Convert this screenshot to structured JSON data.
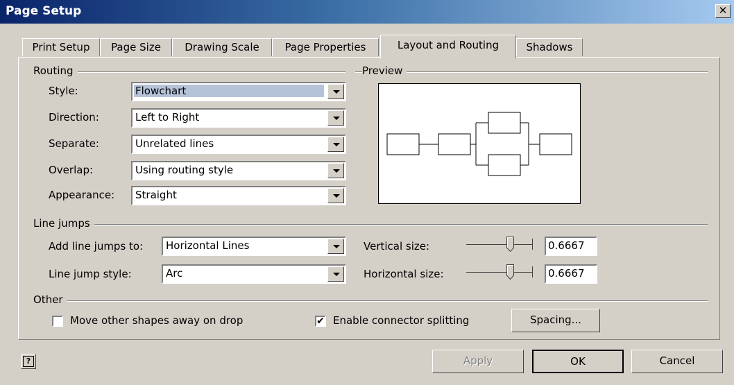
{
  "window": {
    "title": "Page Setup"
  },
  "tabs": [
    {
      "label": "Print Setup"
    },
    {
      "label": "Page Size"
    },
    {
      "label": "Drawing Scale"
    },
    {
      "label": "Page Properties"
    },
    {
      "label": "Layout and Routing",
      "active": true
    },
    {
      "label": "Shadows"
    }
  ],
  "routing": {
    "group_label": "Routing",
    "style": {
      "label": "Style:",
      "value": "Flowchart"
    },
    "direction": {
      "label": "Direction:",
      "value": "Left to Right"
    },
    "separate": {
      "label": "Separate:",
      "value": "Unrelated lines"
    },
    "overlap": {
      "label": "Overlap:",
      "value": "Using routing style"
    },
    "appearance": {
      "label": "Appearance:",
      "value": "Straight"
    }
  },
  "preview": {
    "group_label": "Preview"
  },
  "line_jumps": {
    "group_label": "Line jumps",
    "add_to": {
      "label": "Add line jumps to:",
      "value": "Horizontal Lines"
    },
    "style": {
      "label": "Line jump style:",
      "value": "Arc"
    },
    "vertical_size": {
      "label": "Vertical size:",
      "value": "0.6667"
    },
    "horizontal_size": {
      "label": "Horizontal size:",
      "value": "0.6667"
    }
  },
  "other": {
    "group_label": "Other",
    "move_shapes": {
      "label": "Move other shapes away on drop",
      "checked": false
    },
    "connector_splitting": {
      "label": "Enable connector splitting",
      "checked": true,
      "mark": "✔"
    },
    "spacing_button": "Spacing..."
  },
  "footer": {
    "help_icon": "?",
    "apply": "Apply",
    "ok": "OK",
    "cancel": "Cancel"
  },
  "colors": {
    "title_start": "#0a246a",
    "title_end": "#a6caf0",
    "face": "#d4d0c8"
  }
}
